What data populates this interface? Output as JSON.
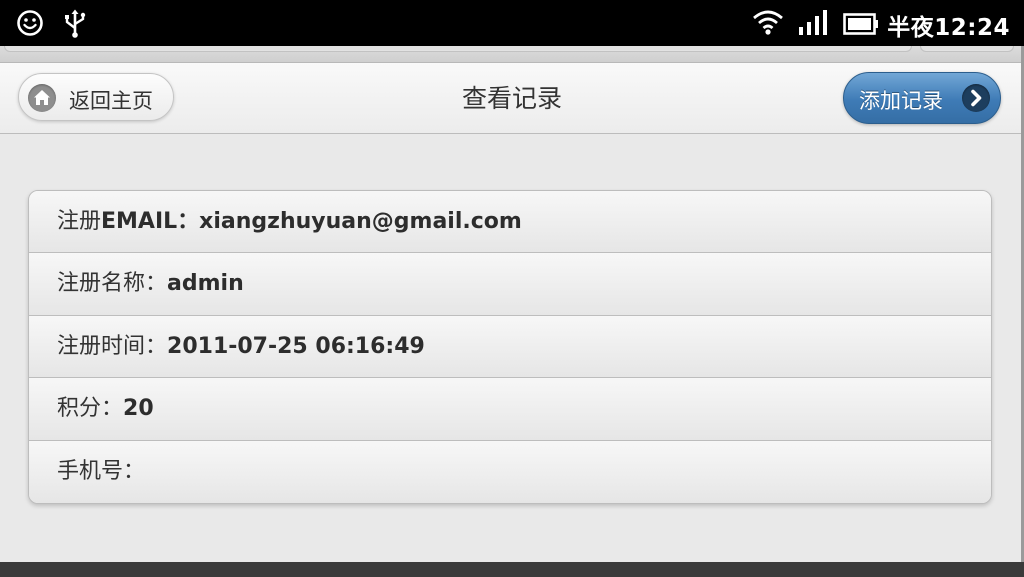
{
  "status_bar": {
    "time_prefix": "半夜",
    "time": "12:24",
    "icons": [
      "smiley-icon",
      "usb-icon",
      "wifi-icon",
      "signal-icon",
      "battery-icon"
    ]
  },
  "header": {
    "title": "查看记录",
    "back_label": "返回主页",
    "back_icon": "home-icon",
    "add_label": "添加记录",
    "add_icon": "chevron-right-icon",
    "accent_color": "#3e7bb6"
  },
  "records": [
    {
      "label": "注册",
      "value": "EMAIL：xiangzhuyuan@gmail.com"
    },
    {
      "label": "注册名称：",
      "value": "admin"
    },
    {
      "label": "注册时间：",
      "value": "2011-07-25 06:16:49"
    },
    {
      "label": "积分：",
      "value": "20"
    },
    {
      "label": "手机号：",
      "value": ""
    }
  ]
}
